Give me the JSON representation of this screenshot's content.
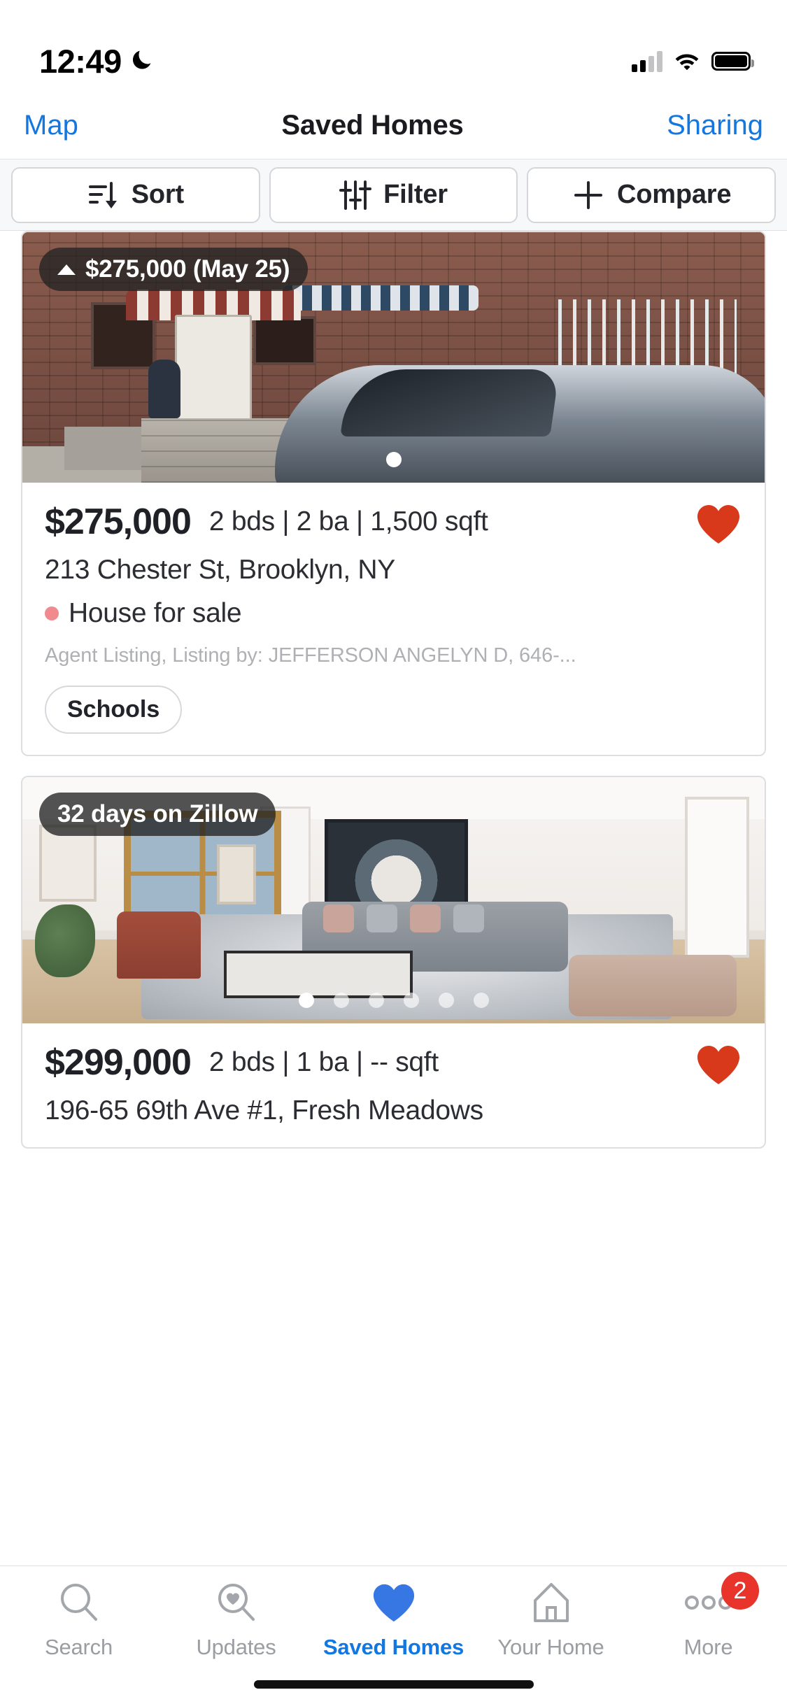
{
  "status_bar": {
    "time": "12:49",
    "dnd_icon": "moon-icon",
    "cellular_icon": "cellular-bars-icon",
    "wifi_icon": "wifi-icon",
    "battery_icon": "battery-icon"
  },
  "nav": {
    "left_label": "Map",
    "title": "Saved Homes",
    "right_label": "Sharing",
    "link_color": "#1277e1"
  },
  "toolbar": {
    "buttons": [
      {
        "label": "Sort",
        "icon": "sort-descending-icon"
      },
      {
        "label": "Filter",
        "icon": "filter-sliders-icon"
      },
      {
        "label": "Compare",
        "icon": "plus-icon"
      }
    ]
  },
  "listings": [
    {
      "badge": {
        "text": "$275,000 (May 25)",
        "icon": "triangle-up-icon"
      },
      "price": "$275,000",
      "facts": "2 bds | 2 ba | 1,500 sqft",
      "address": "213 Chester St, Brooklyn, NY",
      "status": "House for sale",
      "status_dot_color": "#f08a8f",
      "agent": "Agent Listing, Listing by: JEFFERSON ANGELYN D, 646-...",
      "chip": "Schools",
      "favorite": true,
      "favorite_color": "#d8391b",
      "carousel": {
        "count": 1,
        "active": 0
      }
    },
    {
      "badge": {
        "text": "32 days on Zillow",
        "icon": ""
      },
      "price": "$299,000",
      "facts": "2 bds | 1 ba | -- sqft",
      "address": "196-65 69th Ave #1, Fresh Meadows",
      "favorite": true,
      "favorite_color": "#d8391b",
      "carousel": {
        "count": 6,
        "active": 0
      }
    }
  ],
  "tabbar": {
    "items": [
      {
        "label": "Search",
        "icon": "search-icon",
        "active": false
      },
      {
        "label": "Updates",
        "icon": "search-heart-icon",
        "active": false
      },
      {
        "label": "Saved Homes",
        "icon": "heart-icon",
        "active": true
      },
      {
        "label": "Your Home",
        "icon": "house-icon",
        "active": false
      },
      {
        "label": "More",
        "icon": "ellipsis-icon",
        "active": false,
        "badge": "2"
      }
    ],
    "active_color": "#1277e1",
    "inactive_color": "#9a9da1",
    "badge_color": "#e8342a"
  }
}
